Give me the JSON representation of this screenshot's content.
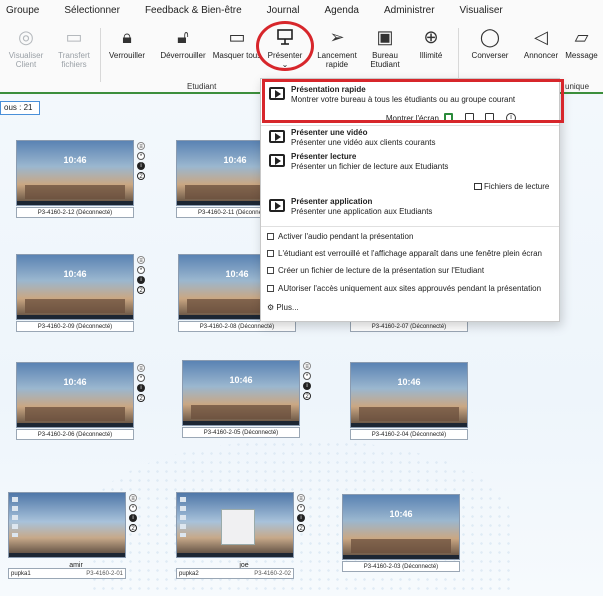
{
  "menu": [
    "Groupe",
    "Sélectionner",
    "Feedback & Bien-être",
    "Journal",
    "Agenda",
    "Administrer",
    "Visualiser"
  ],
  "ribbon": {
    "buttons": [
      {
        "label": "Visualiser Client",
        "icon": "eye-icon",
        "disabled": true
      },
      {
        "label": "Transfert fichiers",
        "icon": "folder-icon",
        "disabled": true
      },
      {
        "label": "Verrouiller",
        "icon": "lock-icon",
        "disabled": false
      },
      {
        "label": "Déverrouiller",
        "icon": "unlock-icon",
        "disabled": false
      },
      {
        "label": "Masquer tous",
        "icon": "monitor-icon",
        "disabled": false
      },
      {
        "label": "Présenter",
        "icon": "presentation-icon",
        "disabled": false
      },
      {
        "label": "Lancement rapide",
        "icon": "send-icon",
        "disabled": false
      },
      {
        "label": "Bureau Etudiant",
        "icon": "remote-desktop-icon",
        "disabled": false
      },
      {
        "label": "Illimité",
        "icon": "globe-icon",
        "disabled": false
      },
      {
        "label": "Converser",
        "icon": "chat-icon",
        "disabled": false
      },
      {
        "label": "Annoncer",
        "icon": "megaphone-icon",
        "disabled": false
      },
      {
        "label": "Message",
        "icon": "message-icon",
        "disabled": false
      }
    ],
    "group_student": "Etudiant",
    "group_unique": "unique"
  },
  "count_tab": "ous : 21",
  "dropdown": {
    "quick": {
      "title": "Présentation rapide",
      "desc": "Montrer votre bureau à tous les étudiants ou au groupe courant",
      "show_screen": "Montrer l'écran"
    },
    "video": {
      "title": "Présenter une vidéo",
      "desc": "Présenter une vidéo aux clients courants"
    },
    "replay": {
      "title": "Présenter lecture",
      "desc": "Présenter un fichier de lecture aux Etudiants",
      "files": "Fichiers de lecture"
    },
    "app": {
      "title": "Présenter application",
      "desc": "Présenter une application aux Etudiants"
    },
    "options": [
      "Activer l'audio pendant la présentation",
      "L'étudiant est verrouillé et l'affichage apparaît dans une fenêtre plein écran",
      "Créer un fichier de lecture de la présentation sur l'Etudiant",
      "AUtoriser l'accès uniquement aux sites approuvés pendant la présentation"
    ],
    "more": "Plus..."
  },
  "thumbs": [
    {
      "time": "10:46",
      "caption": "P3-4160-2-12 (Déconnecté)"
    },
    {
      "time": "10:46",
      "caption": "P3-4160-2-11 (Déconnecté)"
    },
    {
      "time": "10:46",
      "caption": "P3-4160-2-09 (Déconnecté)"
    },
    {
      "time": "10:46",
      "caption": "P3-4160-2-08 (Déconnecté)"
    },
    {
      "time": "",
      "caption": "P3-4160-2-07 (Déconnecté)"
    },
    {
      "time": "10:46",
      "caption": "P3-4160-2-06 (Déconnecté)"
    },
    {
      "time": "10:46",
      "caption": "P3-4160-2-05 (Déconnecté)"
    },
    {
      "time": "10:46",
      "caption": "P3-4160-2-04 (Déconnecté)"
    },
    {
      "user": "amir",
      "left": "pupka1",
      "right": "P3-4160-2-01"
    },
    {
      "user": "joe",
      "left": "pupka2",
      "right": "P3-4160-2-02"
    },
    {
      "time": "10:46",
      "caption": "P3-4160-2-03 (Déconnecté)"
    }
  ]
}
